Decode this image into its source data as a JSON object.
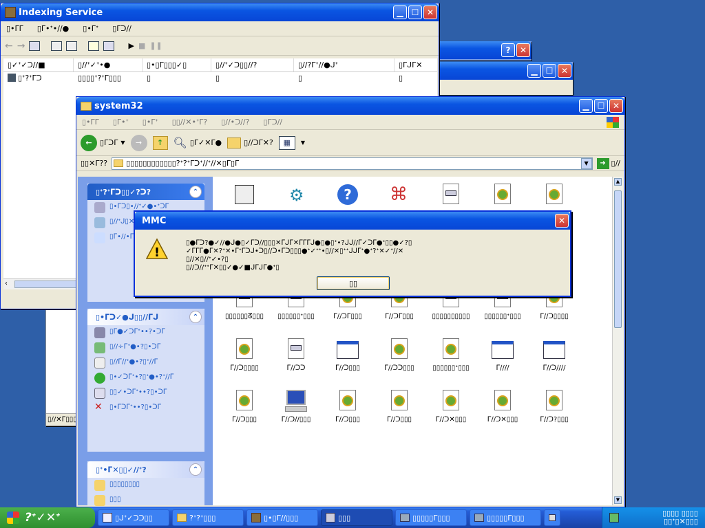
{
  "windows": {
    "indexing": {
      "title": "Indexing Service",
      "menu": [
        "▯•ᒥᒥ",
        "▯ᒥ•ᐩ•∕/●",
        "▯•ᒥᐩ",
        "▯ᒥᑐ∕/"
      ],
      "columns": [
        "▯✓ᐩ✓ᑐ∕/■",
        "▯∕/ᐩ✓ᐩ•●",
        "▯•▯ᒥ▯▯▯✓▯",
        "▯∕/ᐩ✓ᑐ▯▯∕/?",
        "▯∕/?ᒥᐩ∕/●ᒍᐩ",
        "▯ᒥᒍᒥ✕"
      ],
      "row": [
        "▯ᐩ?ᐩᒥᑐ",
        "▯▯▯▯ᐩ?ᐩᒥ▯▯▯",
        "▯",
        "▯",
        "▯",
        "▯"
      ]
    },
    "system32": {
      "title": "system32",
      "menu": [
        "▯•ᒥᒥ",
        "▯ᒥ•ᐩ",
        "▯•ᒥᐩ",
        "▯▯∕/✕•ᐩᒥ?",
        "▯∕/•ᑐ∕/?",
        "▯ᒥᑐ∕/"
      ],
      "back_label": "▯ᒥᑐᒥ",
      "search_label": "▯ᒥ✓✕ᒥ●",
      "folders_label": "▯∕/ᑐᒥ✕?",
      "address_label": "▯▯✕ᒥ??",
      "address_value": "▯▯▯▯▯▯▯▯▯▯▯▯?ᐩ?ᐩᒥᑐᐩ∕/ᐩ∕/✕▯ᒥ▯ᒥ",
      "go_label": "▯∕/",
      "panels": [
        {
          "title": "▯ᐩ?ᐩᒥᑐ▯▯✓?ᑐ?",
          "items": [
            "▯•ᒥᑐ▯•∕/ᐩ✓●•ᐩᑐᒥ",
            "▯∕/ᐩᒍ▯✕∕/ᒥᐩ•ᑐ",
            "▯ᒥ•∕/•ᒥᐩ?ᐩᑐ"
          ]
        },
        {
          "title": "▯•ᒥᑐ✓●ᒍ▯▯∕/ᒥᒍ",
          "items": [
            "▯ᒥ●✓ᑐᒥᐩ••?•ᑐᒥ",
            "▯∕/÷ᒥᐩ●•?▯•ᑐᒥ",
            "▯∕/ᒥ∕/ᐩ●•?▯ᐩ∕/ᒥ",
            "▯•✓ᑐᒥᐩ•?▯ᐩ●•?ᐩ∕/ᒥ",
            "▯▯✓•ᑐᒥᐩ••?▯•ᑐᒥ",
            "▯•ᒥᑐᒥᐩ••?▯•ᑐᒥ"
          ]
        },
        {
          "title": "▯ᐩ•ᒥ✕▯▯✓∕/ᐩ?",
          "items": [
            "▯▯▯▯▯▯▯▯",
            "▯▯▯"
          ]
        }
      ],
      "files": [
        {
          "name": "",
          "icon": "ps-icon"
        },
        {
          "name": "",
          "icon": "gear-icon"
        },
        {
          "name": "",
          "icon": "help-icon"
        },
        {
          "name": "",
          "icon": "cmd-key-icon"
        },
        {
          "name": "▯▯▯",
          "icon": "dll-icon"
        },
        {
          "name": "",
          "icon": "settings-icon"
        },
        {
          "name": "▯▯▯",
          "icon": "settings-icon"
        },
        {
          "name": "ᒥ∕/▯✓▯▯▯",
          "icon": "settings-icon"
        },
        {
          "name": "ᒥ∕/ᑐᒥ▯▯▯",
          "icon": "settings-icon"
        },
        {
          "name": "▯▯▯▯▯ᘔ▯▯▯",
          "icon": "dll-icon"
        },
        {
          "name": "ᒥ∕/ᑐᒥ▯▯▯",
          "icon": "settings-icon"
        },
        {
          "name": "▯▯▯▯▯ᐩ▯▯▯",
          "icon": "settings-icon"
        },
        {
          "name": "ᒥ∕/ᑐᒥ▯▯▯",
          "icon": "settings-icon"
        },
        {
          "name": "▯▯▯▯▯ᐩ▯▯▯",
          "icon": "dll-icon"
        },
        {
          "name": "▯▯▯▯▯▯ᘔ▯▯▯",
          "icon": "dll-icon"
        },
        {
          "name": "▯▯▯▯▯▯ᐩ▯▯▯",
          "icon": "dll-icon"
        },
        {
          "name": "ᒥ∕/ᑐᒥ▯▯▯",
          "icon": "settings-icon"
        },
        {
          "name": "ᒥ∕/ᑐᒥ▯▯▯",
          "icon": "settings-icon"
        },
        {
          "name": "▯▯▯▯▯▯▯▯▯▯",
          "icon": "dll-icon"
        },
        {
          "name": "▯▯▯▯▯▯ᐩ▯▯▯",
          "icon": "dll-icon"
        },
        {
          "name": "ᒥ∕/ᑐ▯▯▯▯",
          "icon": "settings-icon"
        },
        {
          "name": "ᒥ∕/ᑐ▯▯▯▯",
          "icon": "settings-icon"
        },
        {
          "name": "ᒥ∕/ᑐᑐ",
          "icon": "dll-icon"
        },
        {
          "name": "ᒥ∕/ᑐ▯▯▯",
          "icon": "window-icon"
        },
        {
          "name": "ᒥ∕/ᑐᑐ▯▯▯",
          "icon": "settings-icon"
        },
        {
          "name": "▯▯▯▯▯▯ᐩ▯▯▯",
          "icon": "settings-icon"
        },
        {
          "name": "ᒥ∕/∕/",
          "icon": "window-icon"
        },
        {
          "name": "ᒥ∕/ᑐ∕/∕/",
          "icon": "window-icon"
        },
        {
          "name": "ᒥ∕/ᑐ▯▯▯",
          "icon": "settings-icon"
        },
        {
          "name": "ᒥ∕/ᑐ∕/▯▯▯",
          "icon": "computer-icon"
        },
        {
          "name": "ᒥ∕/ᑐ▯▯▯",
          "icon": "settings-icon"
        },
        {
          "name": "ᒥ∕/ᑐ▯▯▯",
          "icon": "settings-icon"
        },
        {
          "name": "ᒥ∕/ᑐ✕▯▯▯",
          "icon": "settings-icon"
        },
        {
          "name": "ᒥ∕/ᑐ✕▯▯▯",
          "icon": "settings-icon"
        },
        {
          "name": "ᒥ∕/ᑐ?▯▯▯",
          "icon": "settings-icon"
        }
      ]
    },
    "bg_status": "▯∕/✕ᒥ▯▯▯"
  },
  "dialog": {
    "title": "MMC",
    "message_line1": "▯●ᒥᑐ?●✓∕/●ᒍ●▯✓ᒥᑐ∕/▯▯▯✕ᒥᒍᒥ✕ᒥᒥᒥᒍ●▯●▯ᐩ•?ᒍᒍ∕/ᒥ✓ᑐᒥ●ᐩ▯▯●✓?▯",
    "message_line2": "✓ᒥᒥᒥ●ᒥ✕?ᐩ✕•ᒥᐩᒥᑐᒍ•ᑐ▯∕/ᑐ•ᒥᑐ▯▯▯●ᐩ✓ᐩᐩ•▯∕/✕▯ᐩᐩᒍᒍᒥᐩ●ᐩ?ᐩ✕✓ᐩ∕/✕",
    "message_line3": "▯∕/✕▯∕/ᐩ✓•?▯",
    "message_line4": "▯∕/ᑐ∕/ᐩᐩᒥ✕▯▯✓●✓■ᒍᒥᒍᒥ●ᐩ▯",
    "ok_label": "▯▯"
  },
  "taskbar": {
    "start_label": "?ᐩ✓✕ᐩ",
    "tasks": [
      {
        "label": "▯ᒍᐩ✓ᑐᑐ▯▯",
        "icon": "notepad-icon"
      },
      {
        "label": "?ᐩ?ᐩ▯▯▯",
        "icon": "folder-icon"
      },
      {
        "label": "▯•▯ᒥ∕/▯▯▯",
        "icon": "app-icon"
      },
      {
        "label": "▯▯▯",
        "icon": "mmc-icon"
      },
      {
        "label": "▯▯▯▯▯ᒥ▯▯▯",
        "icon": "computer-icon"
      },
      {
        "label": "▯▯▯▯▯ᒥ▯▯▯",
        "icon": "computer-icon"
      }
    ],
    "tray_top": "▯▯▯▯ ▯▯▯▯",
    "tray_bottom": "▯▯ᐩ▯✕▯▯▯"
  }
}
